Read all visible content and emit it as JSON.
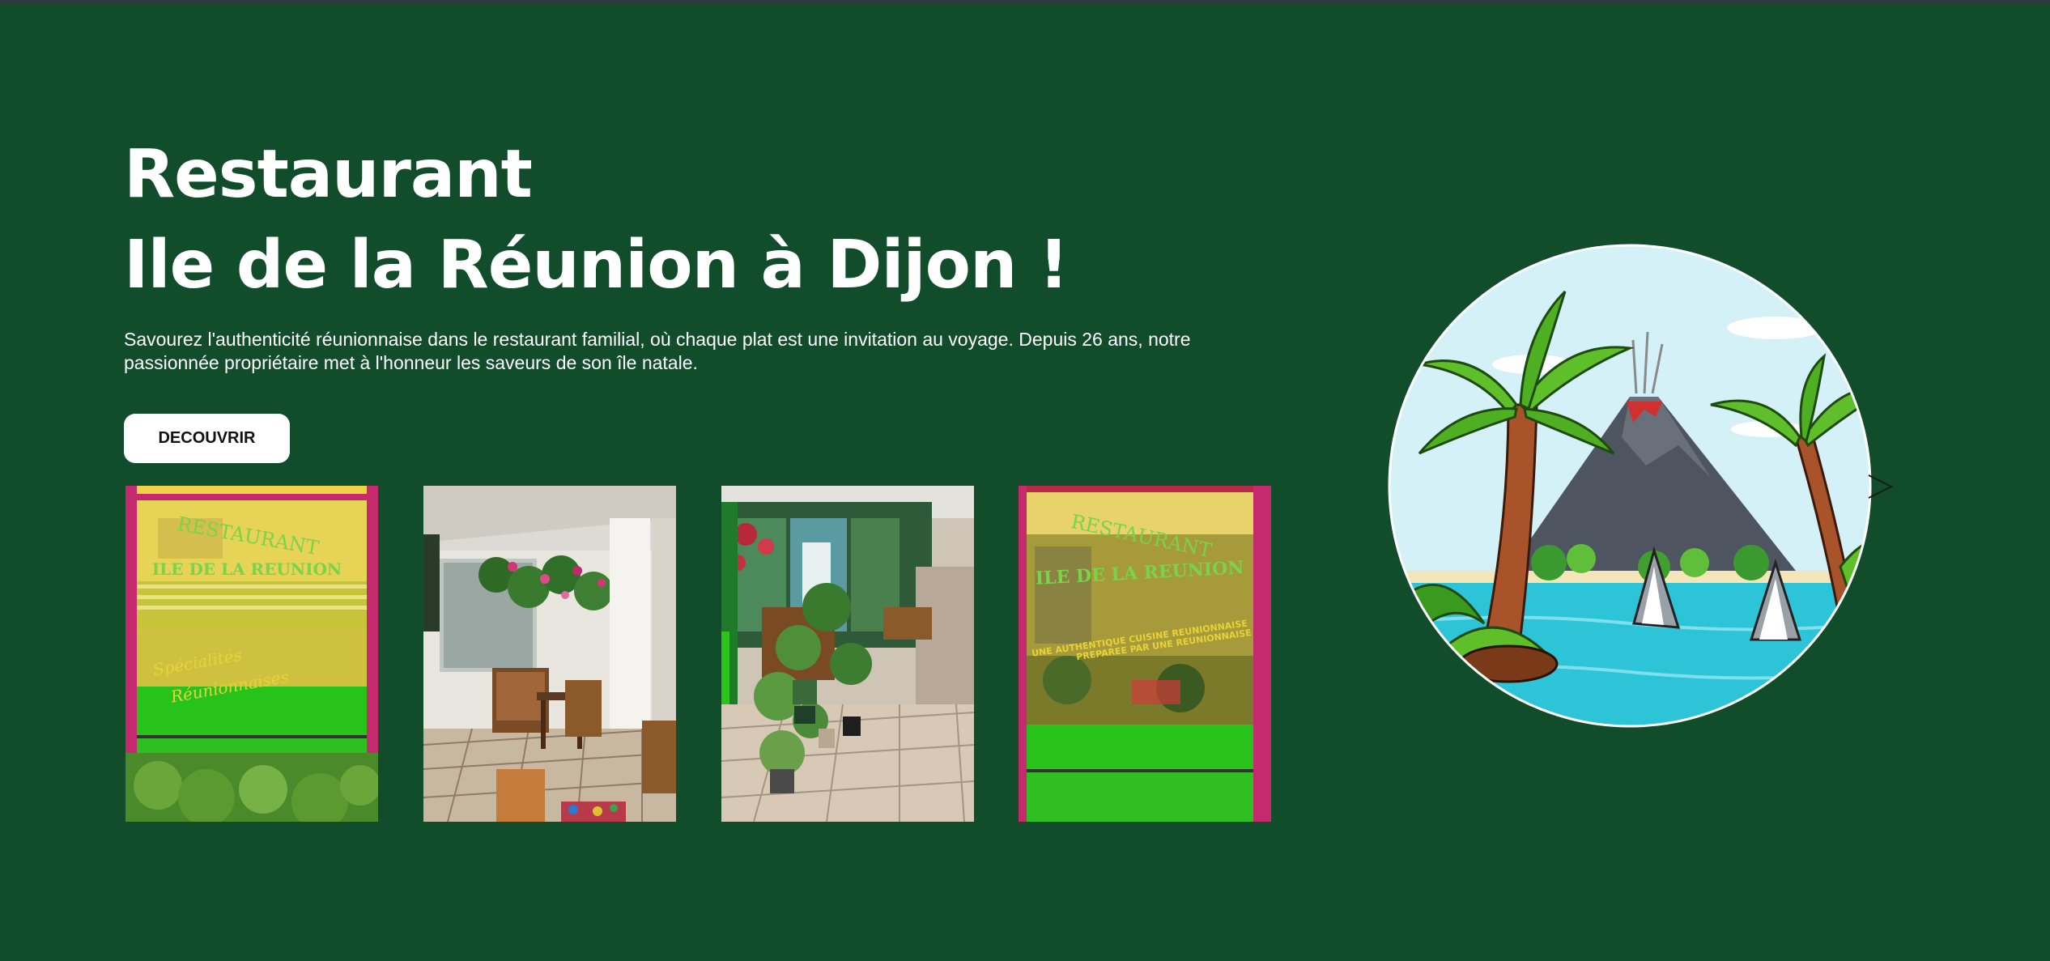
{
  "hero": {
    "title_line1": "Restaurant",
    "title_line2": "Ile de la Réunion à Dijon !",
    "intro": "Savourez l'authenticité réunionnaise dans le restaurant familial, où chaque plat est une invitation au voyage. Depuis 26 ans, notre passionnée propriétaire met à l'honneur les saveurs de son île natale.",
    "cta_label": "DECOUVRIR"
  },
  "photos": {
    "photo1": {
      "sign_line1": "RESTAURANT",
      "sign_line2": "ILE DE LA REUNION",
      "sign_line3": "Spécialités",
      "sign_line4": "Réunionnaises"
    },
    "photo4": {
      "sign_line1": "RESTAURANT",
      "sign_line2": "ILE DE LA REUNION",
      "sign_line3": "UNE AUTHENTIQUE CUISINE REUNIONNAISE",
      "sign_line4": "PREPAREE PAR UNE REUNIONNAISE"
    }
  },
  "icons": {
    "illustration": "tropical-island-volcano-sharks-illustration",
    "arrow": "chevron-right-icon"
  },
  "colors": {
    "background": "#124d2b",
    "cta_background": "#ffffff",
    "title": "#ffffff",
    "sign_text": "#e8d23a",
    "sign_green": "#27c21a",
    "frame_pink": "#c62a6e"
  }
}
